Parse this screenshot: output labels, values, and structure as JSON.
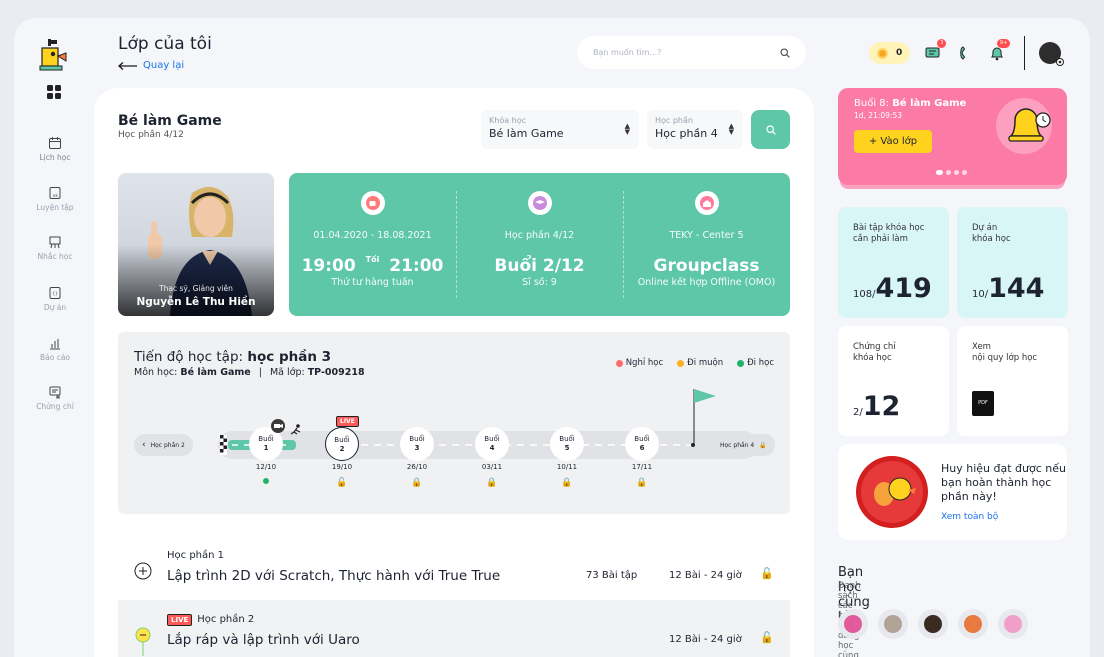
{
  "header": {
    "title": "Lớp của tôi",
    "back_label": "Quay lại",
    "search_placeholder": "Bạn muốn tìm...?",
    "coins": "0",
    "chat_badge": "3",
    "notif_badge": "9+"
  },
  "sidebar": {
    "items": [
      {
        "label": "Lịch học",
        "icon": "calendar-icon"
      },
      {
        "label": "Luyện tập",
        "icon": "practice-icon"
      },
      {
        "label": "Nhắc học",
        "icon": "reminder-icon"
      },
      {
        "label": "Dự án",
        "icon": "project-icon"
      },
      {
        "label": "Báo cáo",
        "icon": "report-icon"
      },
      {
        "label": "Chứng chỉ",
        "icon": "certificate-icon"
      }
    ]
  },
  "course": {
    "title": "Bé làm Game",
    "subtitle": "Học phần 4/12",
    "course_select": {
      "label": "Khóa học",
      "value": "Bé làm Game"
    },
    "module_select": {
      "label": "Học phần",
      "value": "Học phần 4"
    }
  },
  "teacher": {
    "role": "Thạc sỹ, Giảng viên",
    "name": "Nguyễn Lê Thu Hiền"
  },
  "info": {
    "schedule": {
      "dates": "01.04.2020 - 18.08.2021",
      "start": "19:00",
      "tag": "Tối",
      "end": "21:00",
      "note": "Thứ tư hàng tuần"
    },
    "module": {
      "label": "Học phần 4/12",
      "session": "Buổi 2/12",
      "size": "Sĩ số: 9"
    },
    "center": {
      "label": "TEKY - Center 5",
      "type": "Groupclass",
      "mode": "Online kết hợp Offline (OMO)"
    }
  },
  "progress": {
    "title_prefix": "Tiến độ học tập: ",
    "title_module": "học phần 3",
    "course_label": "Môn học: ",
    "course_name": "Bé làm Game",
    "code_label": "Mã lớp: ",
    "code": "TP-009218",
    "sep": "|",
    "legend": {
      "absent": "Nghỉ học",
      "late": "Đi muộn",
      "present": "Đi học"
    },
    "prev": "Học phần 2",
    "next": "Học phần 4",
    "live": "LIVE",
    "sessions": [
      {
        "label": "Buổi",
        "num": "1",
        "date": "12/10"
      },
      {
        "label": "Buổi",
        "num": "2",
        "date": "19/10"
      },
      {
        "label": "Buổi",
        "num": "3",
        "date": "26/10"
      },
      {
        "label": "Buổi",
        "num": "4",
        "date": "03/11"
      },
      {
        "label": "Buổi",
        "num": "5",
        "date": "10/11"
      },
      {
        "label": "Buổi",
        "num": "6",
        "date": "17/11"
      }
    ]
  },
  "lessons": [
    {
      "label": "Học phần 1",
      "title": "Lập trình 2D với Scratch, Thực hành với True True",
      "count": "73 Bài tập",
      "duration": "12 Bài - 24 giờ"
    },
    {
      "label": "Học phần 2",
      "title": "Lắp ráp và lập trình với Uaro",
      "count": "",
      "duration": "12 Bài - 24 giờ",
      "live": "LIVE"
    }
  ],
  "upcoming": {
    "prefix": "Buổi 8: ",
    "title": "Bé làm Game",
    "time": "1d, 21:09:53",
    "button": "+ Vào lớp"
  },
  "stats": {
    "exercises": {
      "label1": "Bài tập khóa học",
      "label2": "cần phải làm",
      "done": "108/",
      "total": "419"
    },
    "projects": {
      "label1": "Dự án",
      "label2": "khóa học",
      "done": "10/",
      "total": "144"
    },
    "certs": {
      "label1": "Chứng chỉ",
      "label2": "khóa học",
      "done": "2/",
      "total": "12"
    },
    "rules": {
      "label1": "Xem",
      "label2": "nội quy lớp học",
      "file": "PDF"
    }
  },
  "badge": {
    "text": "Huy hiệu đạt được nếu bạn hoàn thành học phần này!",
    "link": "Xem toàn bộ"
  },
  "classmates": {
    "title": "Bạn học cùng lớp",
    "subtitle": "Danh sách các bạn học đang học cùng"
  },
  "colors": {
    "accent": "#5ec7a8",
    "pink": "#fb7ba6",
    "yellow": "#ffd21e"
  }
}
